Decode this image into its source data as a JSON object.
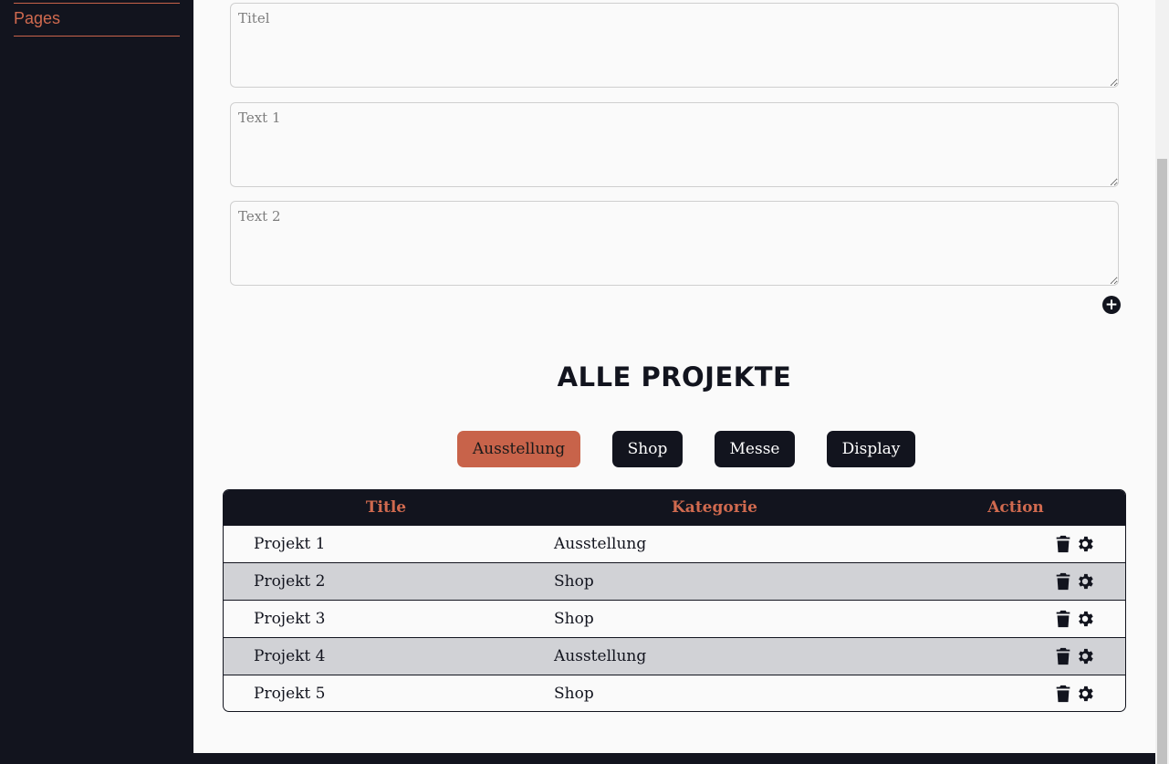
{
  "sidebar": {
    "nav_label": "Pages"
  },
  "form": {
    "title_placeholder": "Titel",
    "text1_placeholder": "Text 1",
    "text2_placeholder": "Text 2",
    "add_icon": "plus-circle-icon"
  },
  "projects": {
    "heading": "ALLE PROJEKTE",
    "filters": [
      "Ausstellung",
      "Shop",
      "Messe",
      "Display"
    ],
    "active_filter": "Ausstellung",
    "columns": [
      "Title",
      "Kategorie",
      "Action"
    ],
    "rows": [
      {
        "title": "Projekt 1",
        "category": "Ausstellung"
      },
      {
        "title": "Projekt 2",
        "category": "Shop"
      },
      {
        "title": "Projekt 3",
        "category": "Shop"
      },
      {
        "title": "Projekt 4",
        "category": "Ausstellung"
      },
      {
        "title": "Projekt 5",
        "category": "Shop"
      }
    ],
    "action_icons": [
      "trash-icon",
      "gear-icon"
    ]
  },
  "colors": {
    "dark": "#12141e",
    "accent": "#c8634a",
    "row_alt": "#d1d2d6",
    "page_bg": "#fafafa"
  }
}
